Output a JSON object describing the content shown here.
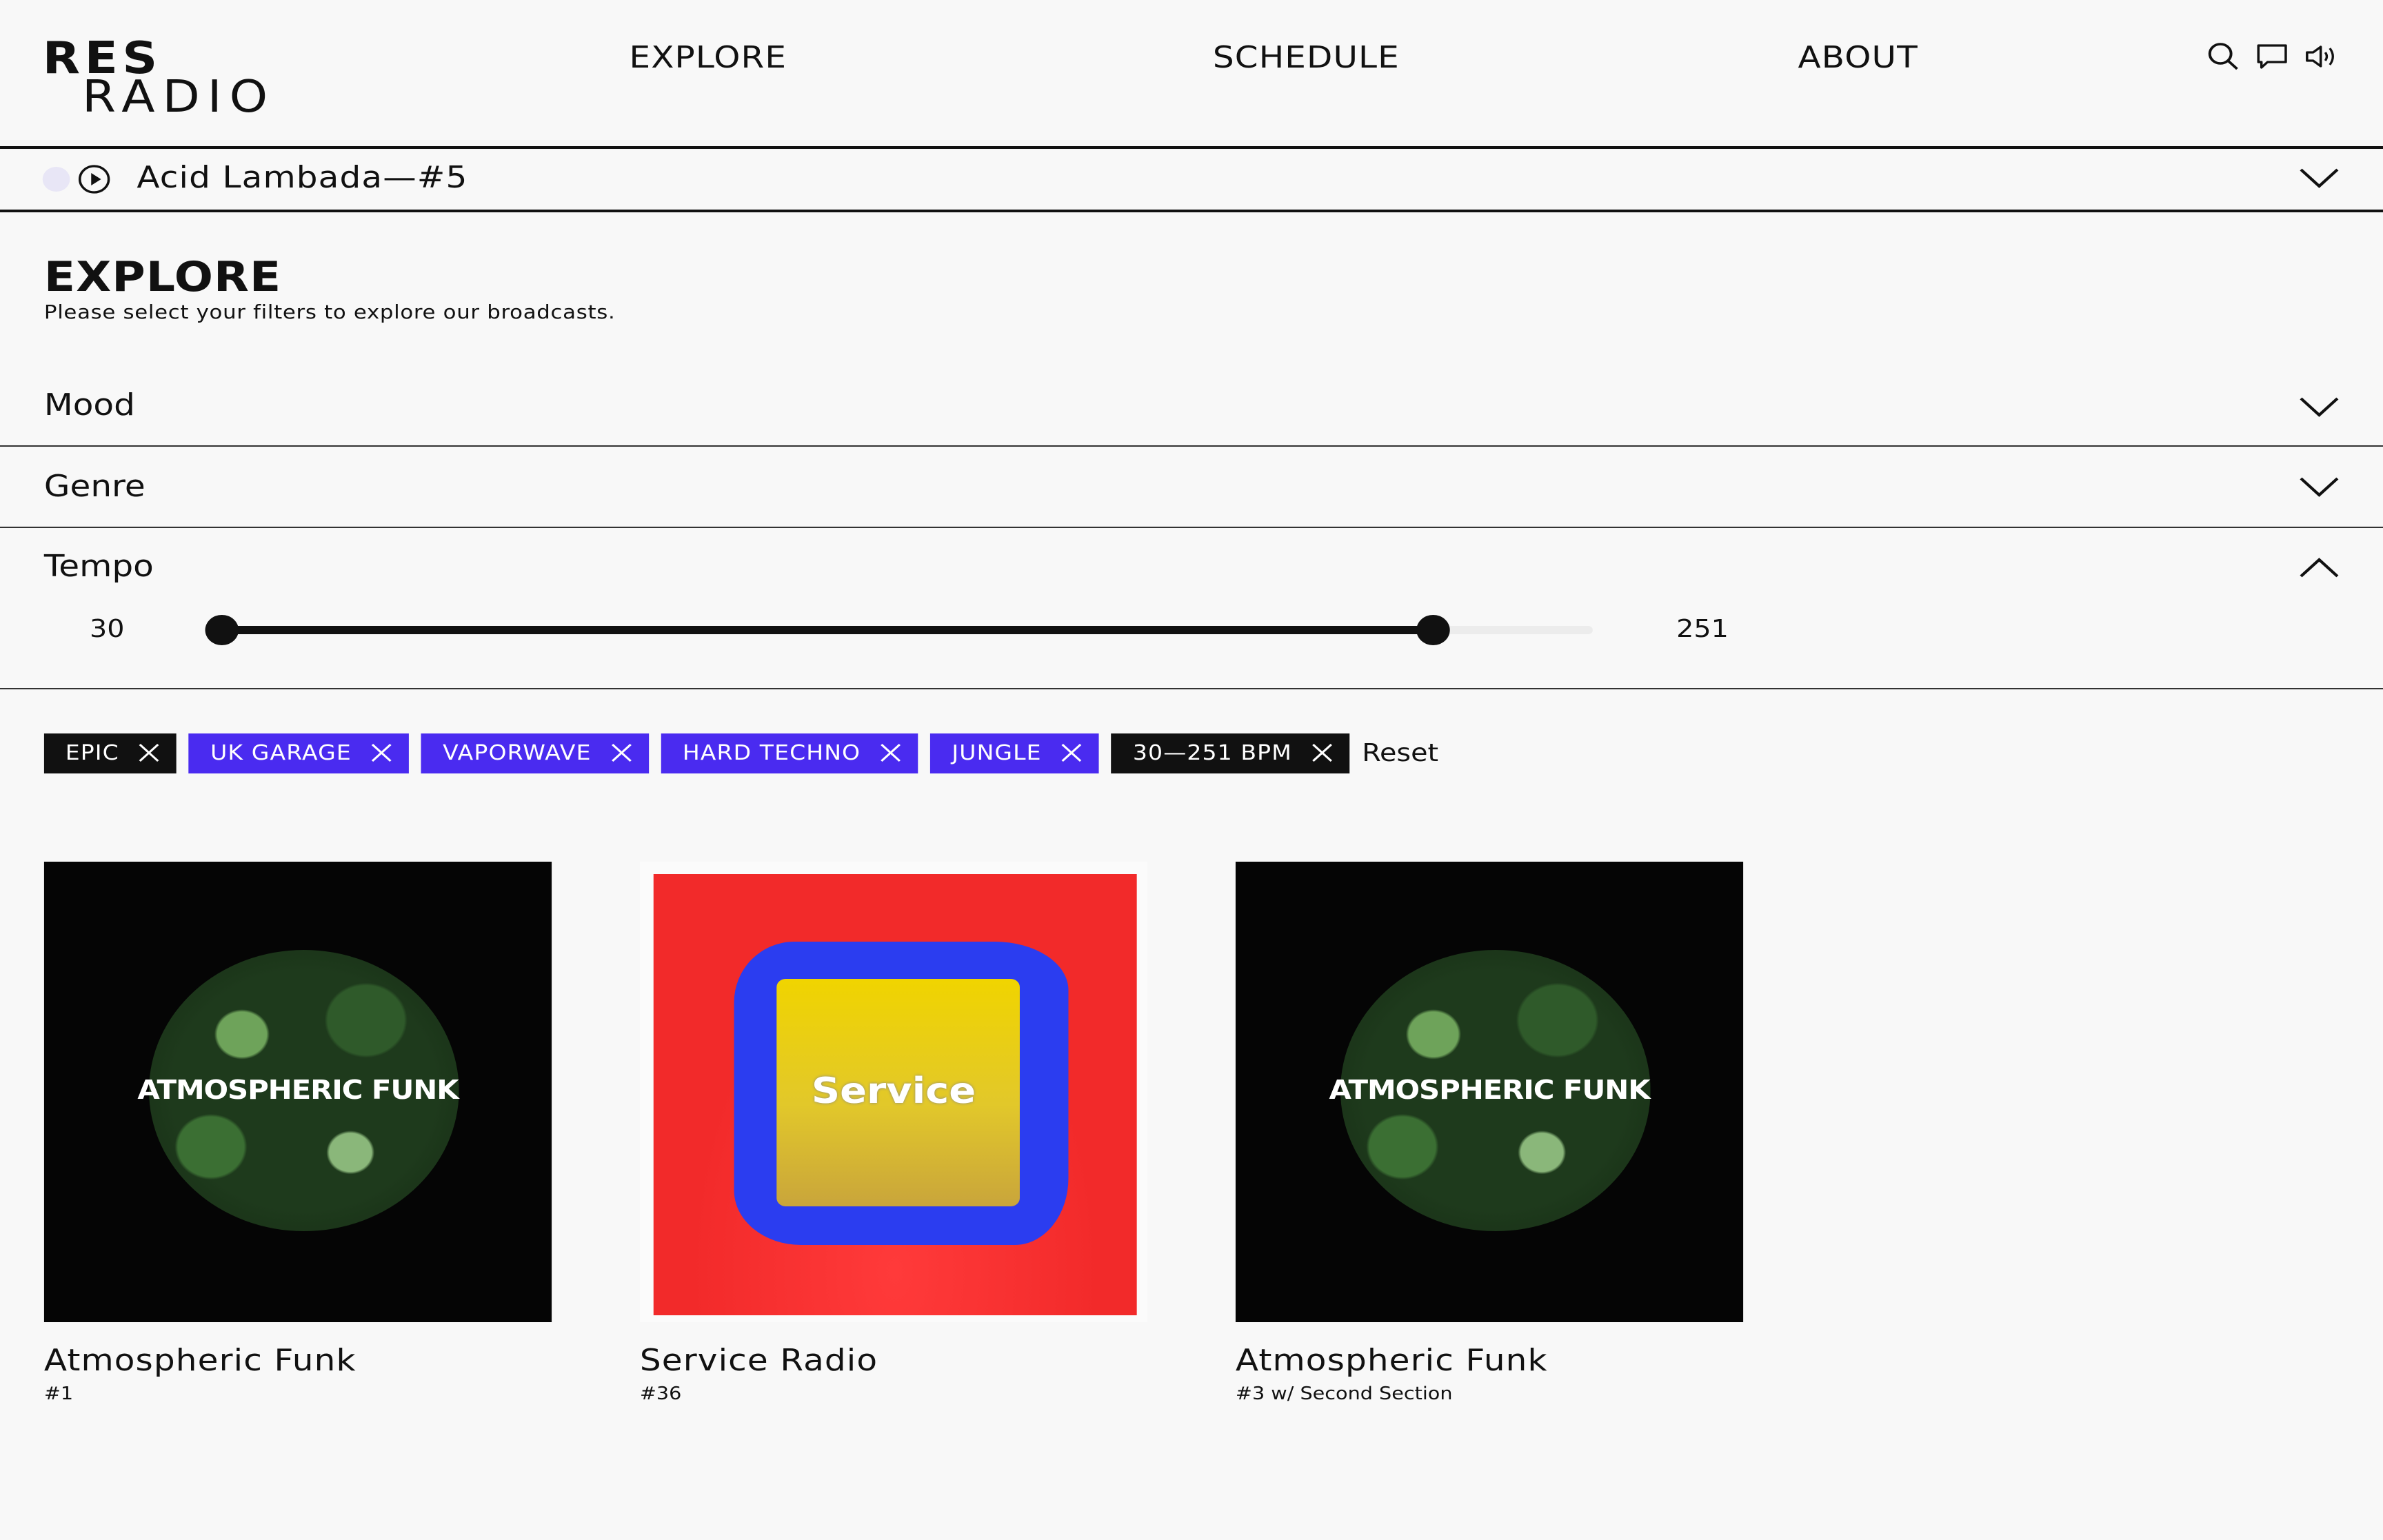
{
  "header": {
    "logo_line1": "RES",
    "logo_line2": "RADIO",
    "nav": {
      "explore": "EXPLORE",
      "schedule": "SCHEDULE",
      "about": "ABOUT"
    }
  },
  "player": {
    "now_playing": "Acid Lambada—#5"
  },
  "explore": {
    "title": "EXPLORE",
    "subtitle": "Please select your filters to explore our broadcasts.",
    "filters": {
      "mood": "Mood",
      "genre": "Genre",
      "tempo": "Tempo"
    },
    "tempo": {
      "min_label": "30",
      "max_label": "251",
      "range_min": 30,
      "range_max": 280,
      "selected_min": 30,
      "selected_max": 251
    }
  },
  "tags": [
    {
      "label": "EPIC",
      "style": "dark"
    },
    {
      "label": "UK GARAGE",
      "style": "blue"
    },
    {
      "label": "VAPORWAVE",
      "style": "blue"
    },
    {
      "label": "HARD TECHNO",
      "style": "blue"
    },
    {
      "label": "JUNGLE",
      "style": "blue"
    },
    {
      "label": "30—251 BPM",
      "style": "dark"
    }
  ],
  "reset_label": "Reset",
  "cards": [
    {
      "title": "Atmospheric Funk",
      "subtitle": "#1",
      "art_text": "ATMOSPHERIC FUNK"
    },
    {
      "title": "Service Radio",
      "subtitle": "#36",
      "art_text": "Service"
    },
    {
      "title": "Atmospheric Funk",
      "subtitle": "#3 w/ Second Section",
      "art_text": "ATMOSPHERIC FUNK"
    }
  ],
  "colors": {
    "accent": "#4a2bf0",
    "dark": "#111111",
    "background": "#f8f8f8"
  }
}
